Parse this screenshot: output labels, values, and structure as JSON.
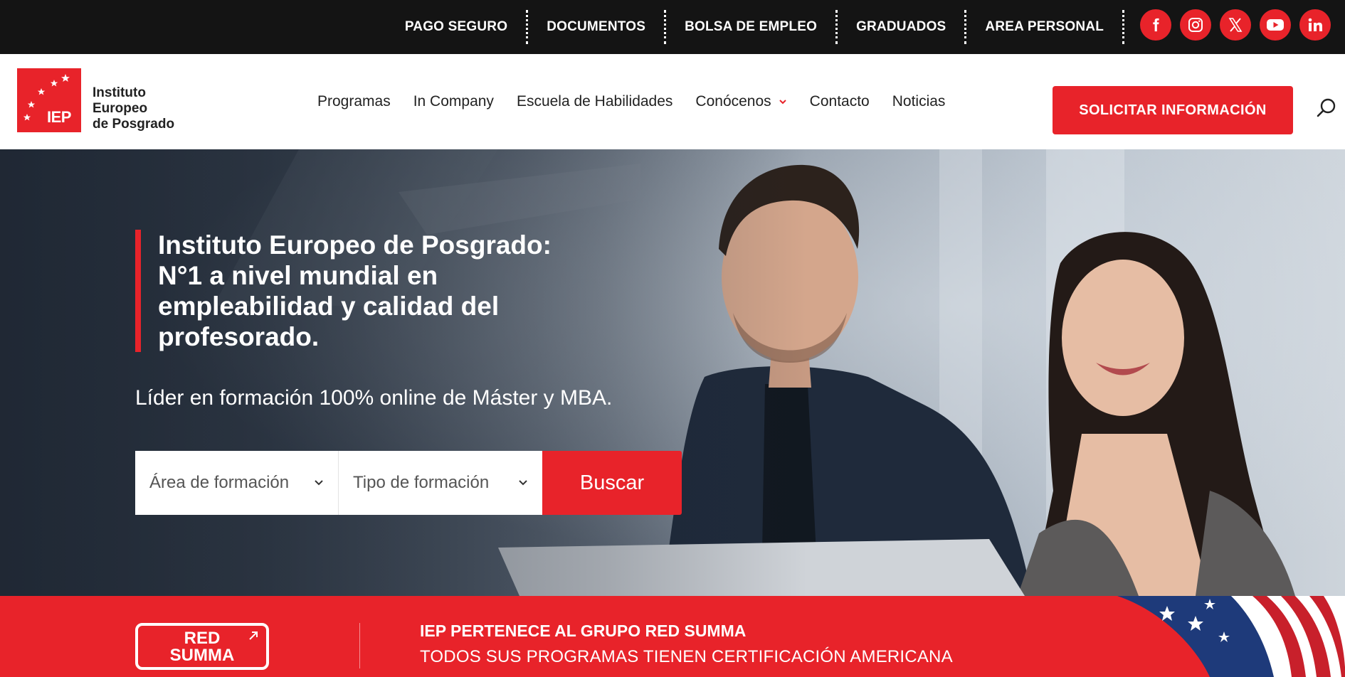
{
  "topbar": {
    "links": [
      "PAGO SEGURO",
      "DOCUMENTOS",
      "BOLSA DE EMPLEO",
      "GRADUADOS",
      "AREA PERSONAL"
    ],
    "socials": [
      "facebook-icon",
      "instagram-icon",
      "x-icon",
      "youtube-icon",
      "linkedin-icon"
    ]
  },
  "header": {
    "logo": {
      "mark": "IEP",
      "line1": "Instituto",
      "line2": "Europeo",
      "line3": "de Posgrado"
    },
    "nav": [
      "Programas",
      "In Company",
      "Escuela de Habilidades",
      "Conócenos",
      "Contacto",
      "Noticias"
    ],
    "cta": "SOLICITAR INFORMACIÓN"
  },
  "hero": {
    "title": "Instituto Europeo de Posgrado: N°1 a nivel mundial en empleabilidad y calidad del profesorado.",
    "subtitle": "Líder en formación 100% online de Máster y MBA.",
    "area_select": "Área de formación",
    "tipo_select": "Tipo de formación",
    "search_button": "Buscar"
  },
  "band": {
    "logo_line1": "RED",
    "logo_line2": "SUMMA",
    "title": "IEP PERTENECE AL GRUPO RED SUMMA",
    "subtitle": "TODOS SUS PROGRAMAS TIENEN CERTIFICACIÓN AMERICANA"
  },
  "colors": {
    "accent": "#e8232a",
    "topbar_bg": "#141414"
  }
}
